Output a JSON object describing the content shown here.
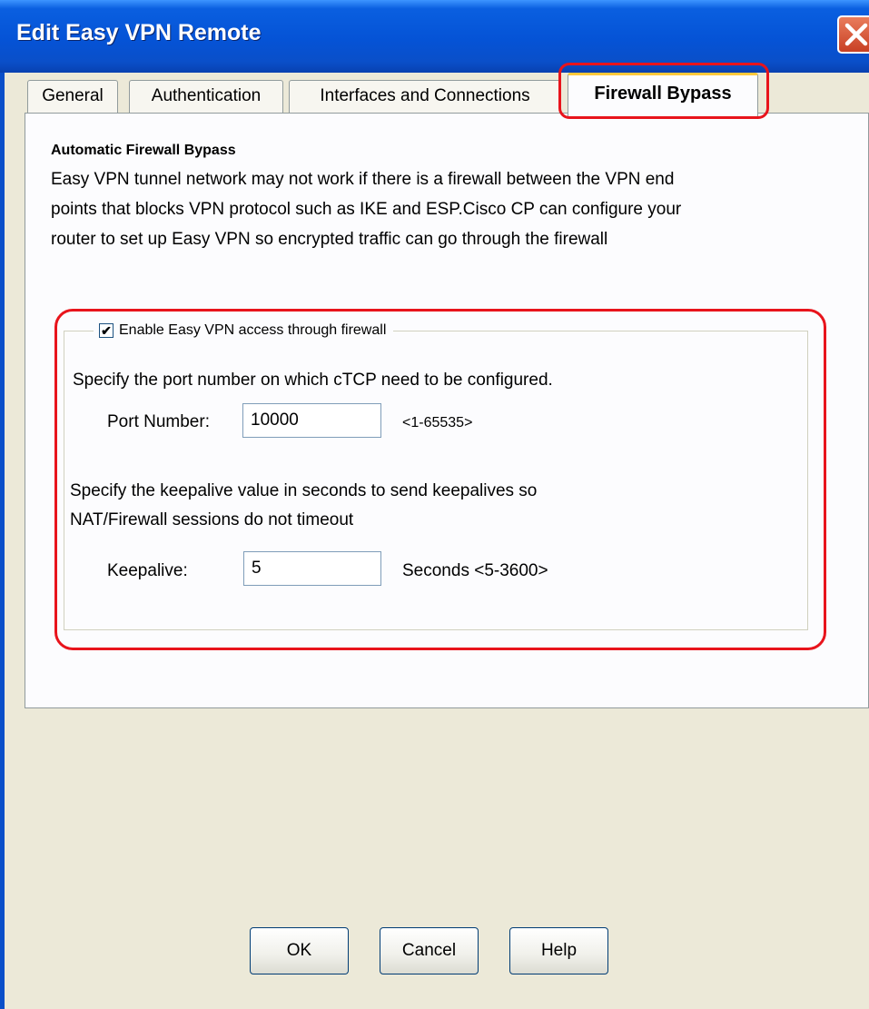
{
  "window": {
    "title": "Edit Easy VPN Remote"
  },
  "tabs": [
    {
      "label": "General"
    },
    {
      "label": "Authentication"
    },
    {
      "label": "Interfaces and Connections"
    },
    {
      "label": "Firewall Bypass",
      "active": true
    }
  ],
  "panel": {
    "section_title": "Automatic Firewall Bypass",
    "description_lines": [
      "Easy VPN tunnel network may not work if there is a firewall between the VPN end",
      "points that blocks VPN protocol such as IKE and ESP.Cisco CP can configure your",
      "router to set up Easy VPN so encrypted traffic can go through the firewall"
    ],
    "group": {
      "checkbox_label": "Enable Easy VPN access through firewall",
      "checkbox_checked": true,
      "checkbox_glyph": "✔",
      "port_instruction": "Specify the port number on which cTCP need to be configured.",
      "port_label": "Port Number:",
      "port_value": "10000",
      "port_range": "<1-65535>",
      "keepalive_instruction_lines": [
        "Specify the keepalive value in seconds to send keepalives so",
        "NAT/Firewall sessions do not timeout"
      ],
      "keepalive_label": "Keepalive:",
      "keepalive_value": "5",
      "keepalive_range": "Seconds <5-3600>"
    }
  },
  "buttons": {
    "ok": "OK",
    "cancel": "Cancel",
    "help": "Help"
  },
  "colors": {
    "highlight": "#e8141c",
    "titlebar": "#0553d6",
    "close_button": "#c84024"
  },
  "icons": {
    "close": "close-icon"
  }
}
